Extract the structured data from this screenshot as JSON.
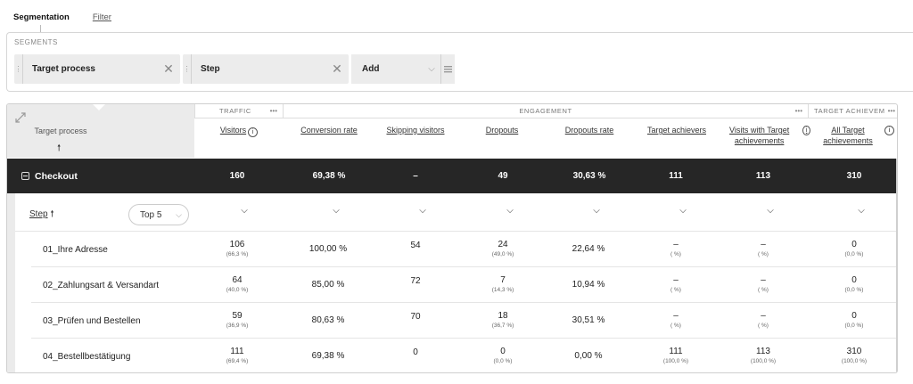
{
  "tabs": {
    "segmentation": "Segmentation",
    "filter": "Filter"
  },
  "segments": {
    "title": "SEGMENTS",
    "chips": [
      {
        "label": "Target process"
      },
      {
        "label": "Step"
      }
    ],
    "add_label": "Add"
  },
  "table": {
    "row_dimension": "Target process",
    "groups": {
      "traffic": "TRAFFIC",
      "engagement": "ENGAGEMENT",
      "target": "TARGET ACHIEVEM"
    },
    "columns": [
      "Visitors",
      "Conversion rate",
      "Skipping visitors",
      "Dropouts",
      "Dropouts rate",
      "Target achievers",
      "Visits with Target achievements",
      "All Target achievements"
    ],
    "total": {
      "label": "Checkout",
      "values": [
        "160",
        "69,38 %",
        "–",
        "49",
        "30,63 %",
        "111",
        "113",
        "310"
      ]
    },
    "sub": {
      "dimension": "Step",
      "top_label": "Top 5"
    },
    "rows": [
      {
        "name": "01_Ihre Adresse",
        "cells": [
          [
            "106",
            "(66,3 %)"
          ],
          [
            "100,00 %",
            ""
          ],
          [
            "54",
            ""
          ],
          [
            "24",
            "(49,0 %)"
          ],
          [
            "22,64 %",
            ""
          ],
          [
            "–",
            "( %)"
          ],
          [
            "–",
            "( %)"
          ],
          [
            "0",
            "(0,0 %)"
          ]
        ]
      },
      {
        "name": "02_Zahlungsart & Versandart",
        "cells": [
          [
            "64",
            "(40,0 %)"
          ],
          [
            "85,00 %",
            ""
          ],
          [
            "72",
            ""
          ],
          [
            "7",
            "(14,3 %)"
          ],
          [
            "10,94 %",
            ""
          ],
          [
            "–",
            "( %)"
          ],
          [
            "–",
            "( %)"
          ],
          [
            "0",
            "(0,0 %)"
          ]
        ]
      },
      {
        "name": "03_Prüfen und Bestellen",
        "cells": [
          [
            "59",
            "(36,9 %)"
          ],
          [
            "80,63 %",
            ""
          ],
          [
            "70",
            ""
          ],
          [
            "18",
            "(36,7 %)"
          ],
          [
            "30,51 %",
            ""
          ],
          [
            "–",
            "( %)"
          ],
          [
            "–",
            "( %)"
          ],
          [
            "0",
            "(0,0 %)"
          ]
        ]
      },
      {
        "name": "04_Bestellbestätigung",
        "cells": [
          [
            "111",
            "(69,4 %)"
          ],
          [
            "69,38 %",
            ""
          ],
          [
            "0",
            ""
          ],
          [
            "0",
            "(0,0 %)"
          ],
          [
            "0,00 %",
            ""
          ],
          [
            "111",
            "(100,0 %)"
          ],
          [
            "113",
            "(100,0 %)"
          ],
          [
            "310",
            "(100,0 %)"
          ]
        ]
      }
    ]
  }
}
